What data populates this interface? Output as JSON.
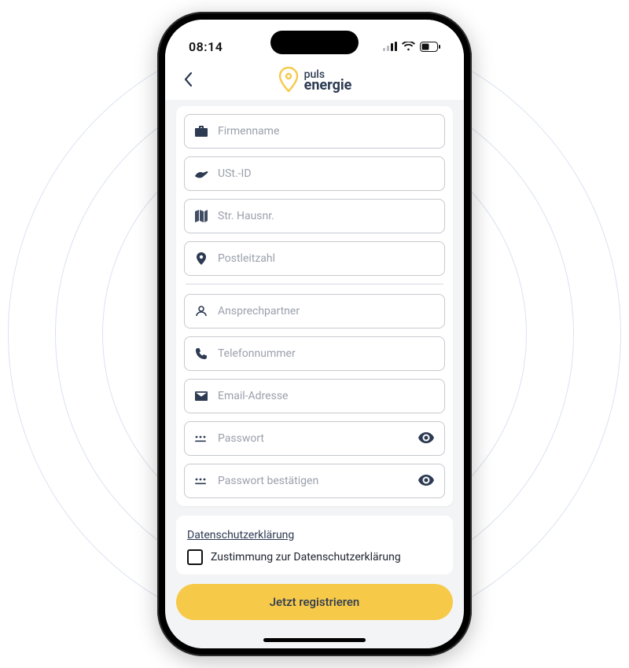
{
  "status": {
    "time": "08:14"
  },
  "logo": {
    "word1": "puls",
    "word2": "energie"
  },
  "fields": {
    "company": {
      "placeholder": "Firmenname"
    },
    "vat": {
      "placeholder": "USt.-ID"
    },
    "street": {
      "placeholder": "Str. Hausnr."
    },
    "zip": {
      "placeholder": "Postleitzahl"
    },
    "contact": {
      "placeholder": "Ansprechpartner"
    },
    "phone": {
      "placeholder": "Telefonnummer"
    },
    "email": {
      "placeholder": "Email-Adresse"
    },
    "password": {
      "placeholder": "Passwort"
    },
    "password2": {
      "placeholder": "Passwort bestätigen"
    }
  },
  "privacy": {
    "link_label": "Datenschutzerklärung",
    "consent_label": "Zustimmung zur Datenschutzerklärung"
  },
  "register_label": "Jetzt registrieren"
}
